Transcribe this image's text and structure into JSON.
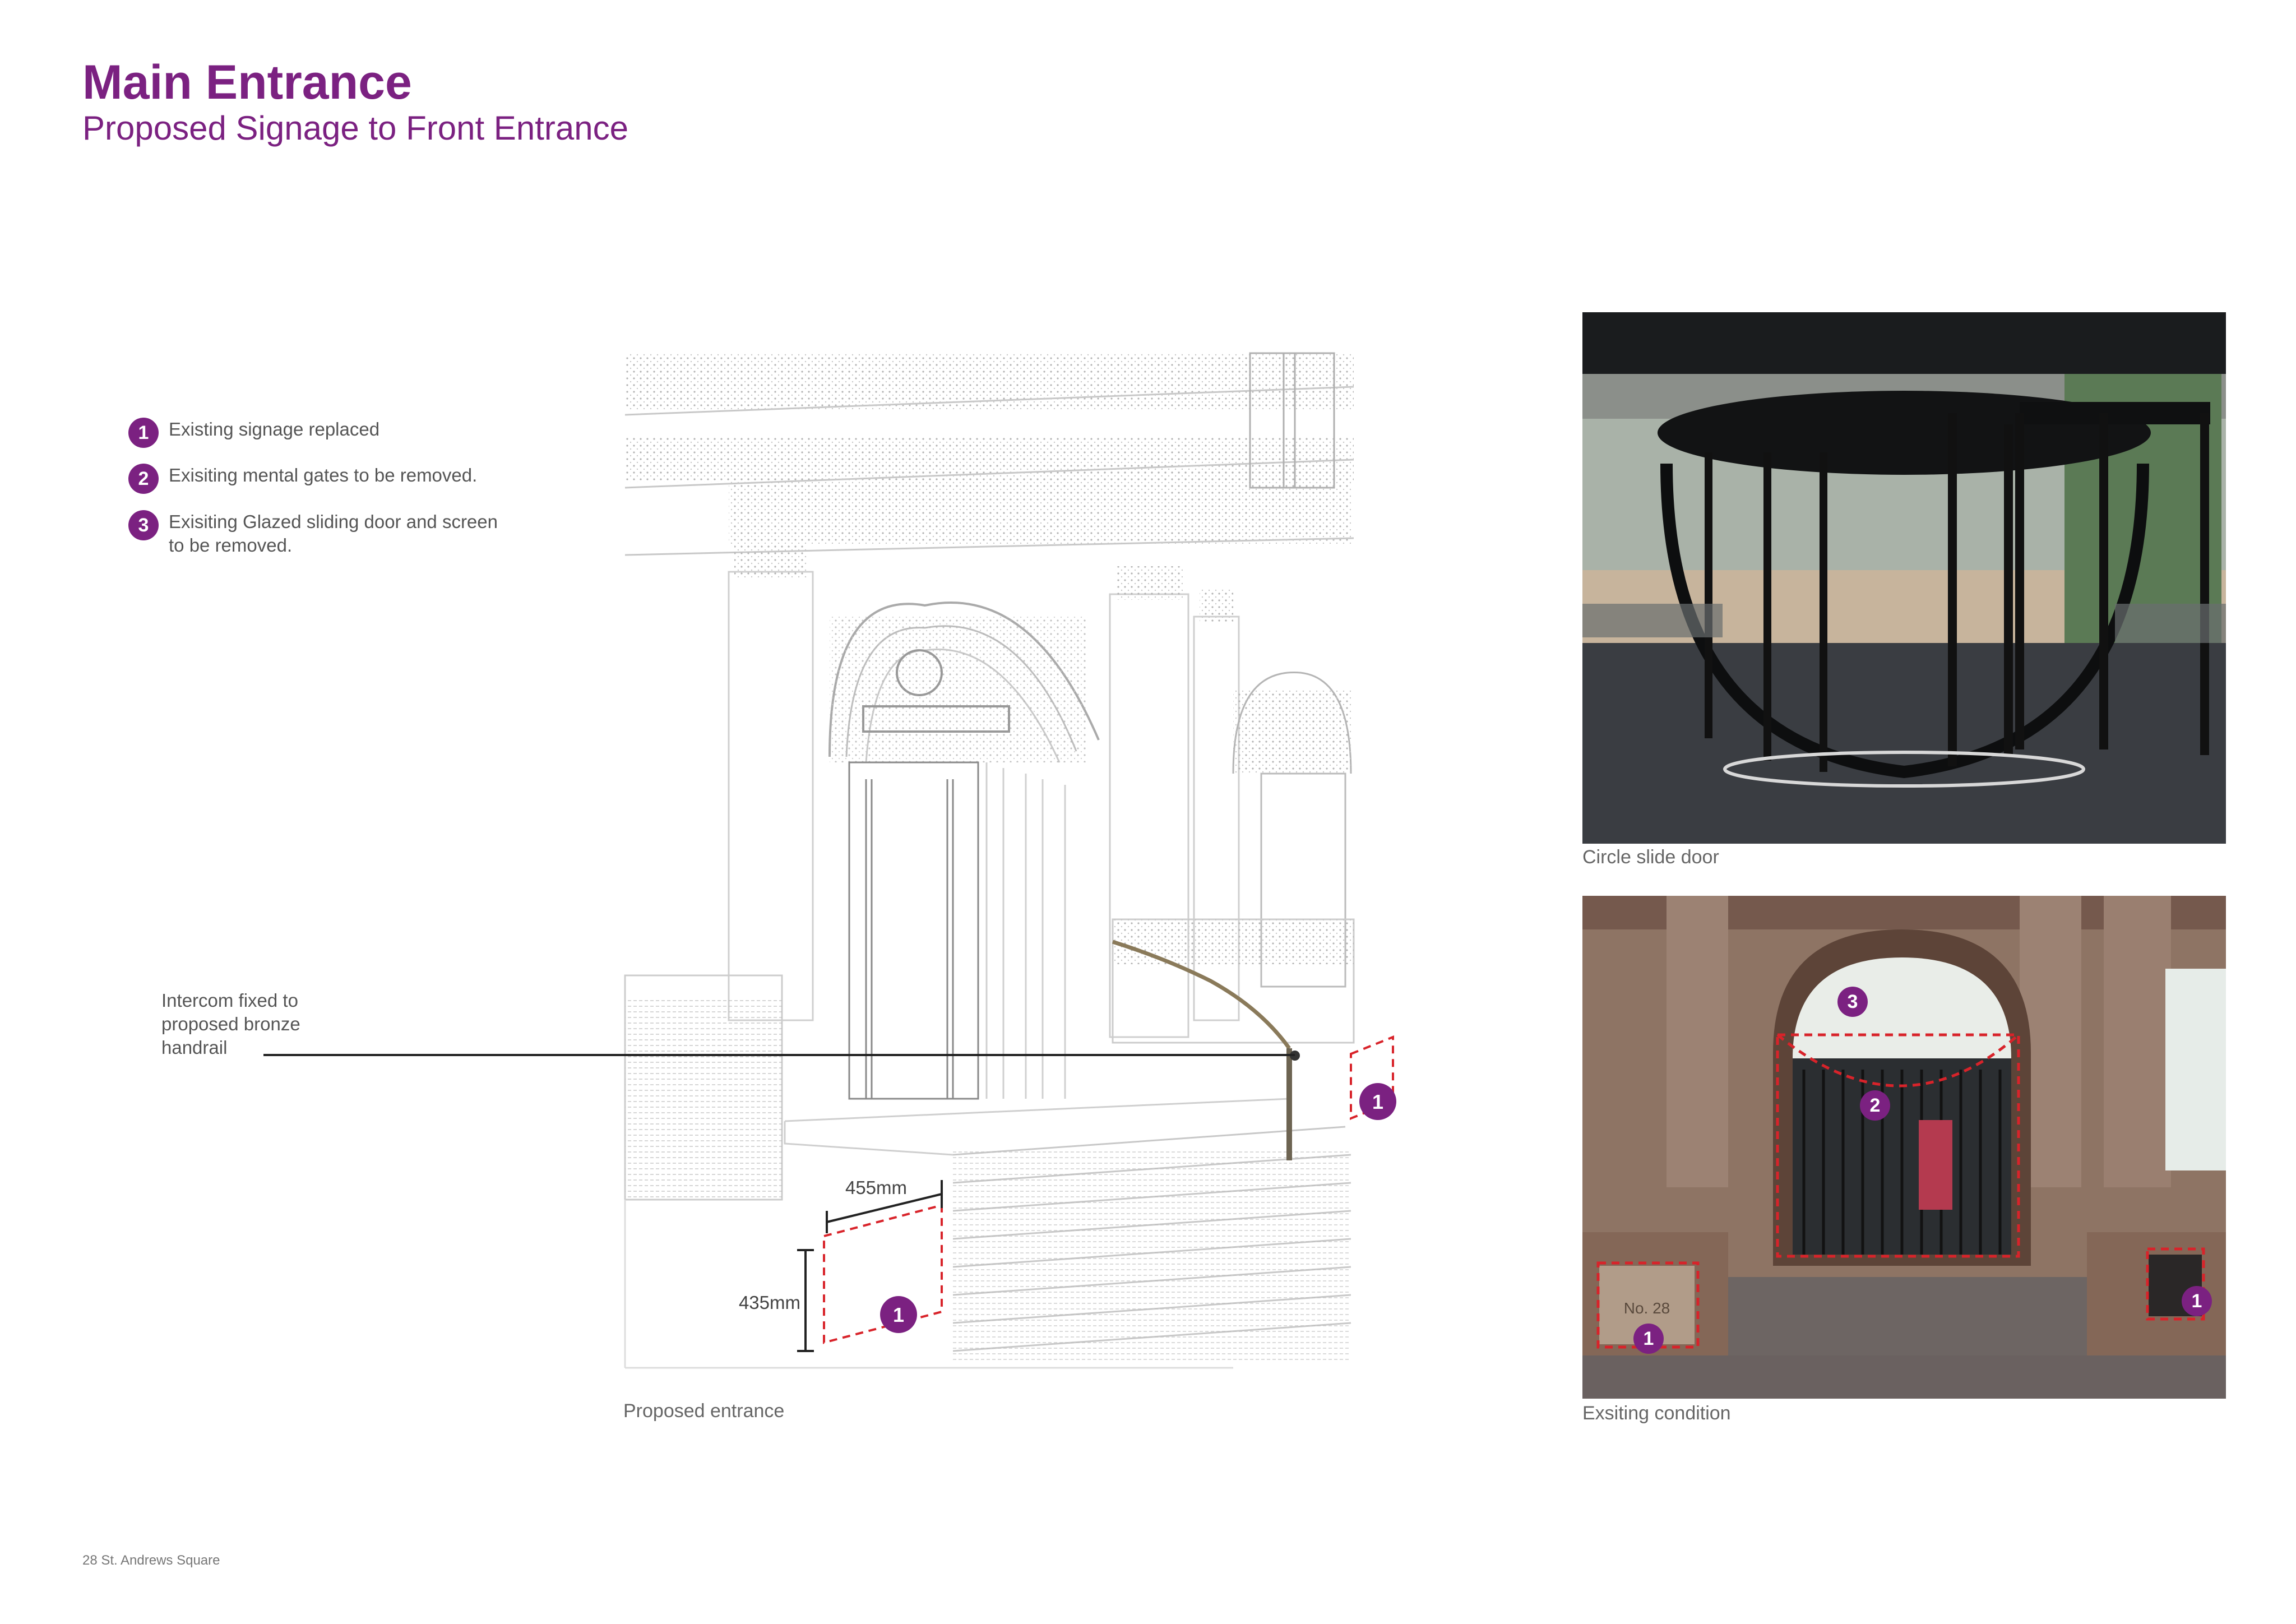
{
  "header": {
    "title": "Main Entrance",
    "subtitle": "Proposed Signage to Front Entrance"
  },
  "legend": [
    {
      "number": "1",
      "text": "Existing signage replaced"
    },
    {
      "number": "2",
      "text": "Exisiting mental gates to be removed."
    },
    {
      "number": "3",
      "text": "Exisiting Glazed sliding door and screen to be removed."
    }
  ],
  "annotation": {
    "intercom_note": "Intercom fixed to proposed bronze handrail",
    "width_dimension": "455mm",
    "height_dimension": "435mm",
    "sign_marker": "1",
    "handrail_sign_marker": "1"
  },
  "captions": {
    "proposed": "Proposed entrance",
    "circle_door": "Circle slide door",
    "existing": "Exsiting condition"
  },
  "photo_markers": {
    "door": "3",
    "gates": "2",
    "plaque_left": "1",
    "plaque_right": "1"
  },
  "plaque_text": "No. 28",
  "footer": "28 St. Andrews Square",
  "colors": {
    "brand_purple": "#7b2181",
    "marker_red": "#d8232a"
  }
}
